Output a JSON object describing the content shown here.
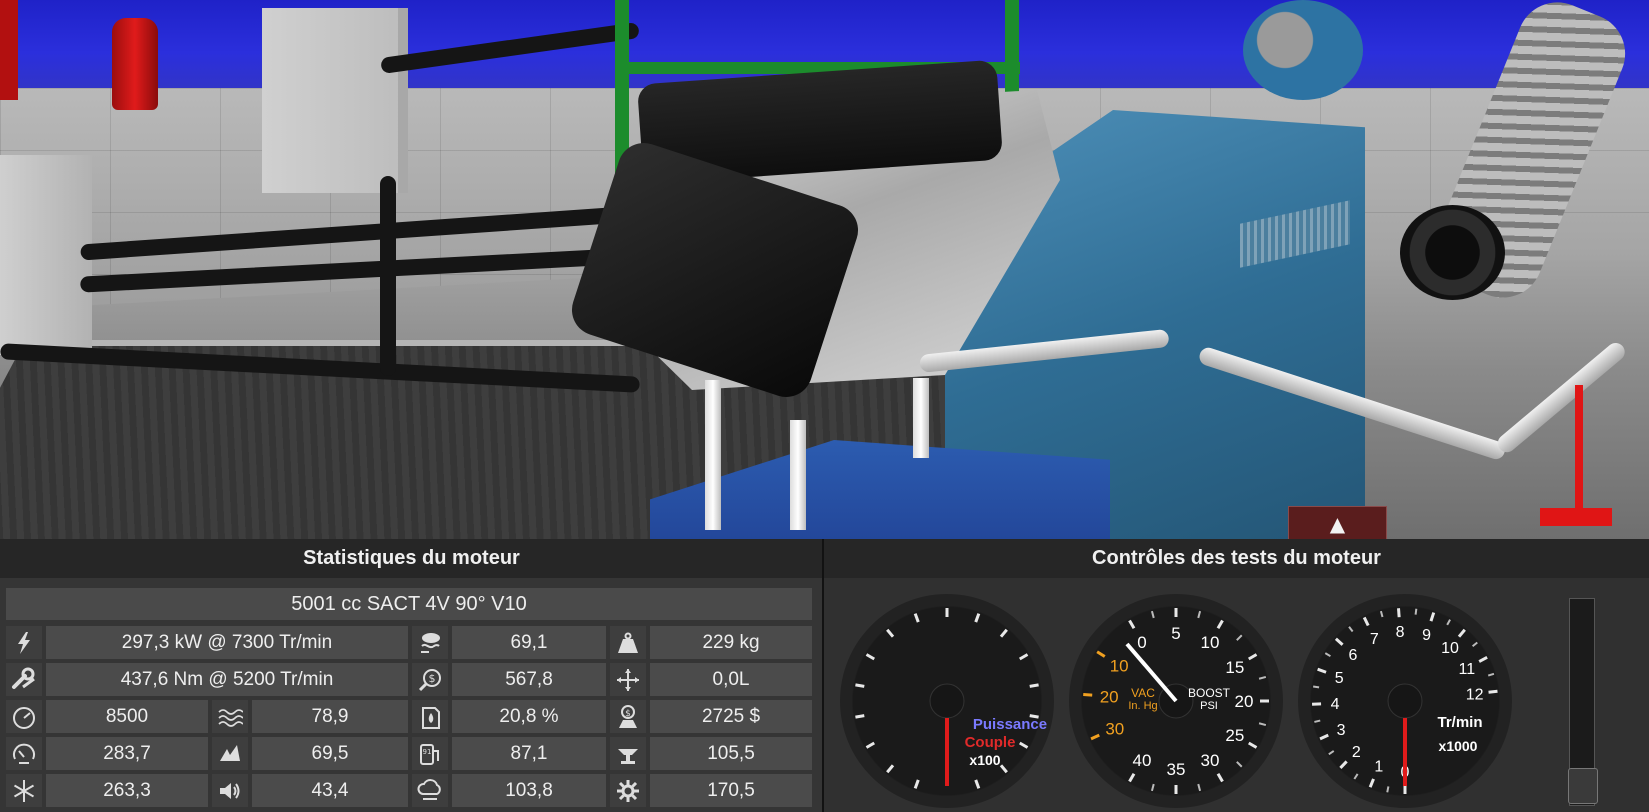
{
  "scene": {
    "collapse_arrow": "▲"
  },
  "stats": {
    "title": "Statistiques du moteur",
    "engine_name": "5001 cc SACT 4V 90° V10",
    "rows": [
      {
        "power": {
          "icon": "power-icon",
          "value": "297,3 kW @ 7300 Tr/min"
        },
        "c2": {
          "icon": "emissions-icon",
          "value": "69,1"
        },
        "c3": {
          "icon": "weight-icon",
          "value": "229 kg"
        }
      },
      {
        "torque": {
          "icon": "torque-wrench-icon",
          "value": "437,6 Nm @ 5200 Tr/min"
        },
        "c2": {
          "icon": "service-cost-icon",
          "value": "567,8"
        },
        "c3": {
          "icon": "dimensions-icon",
          "value": "0,0L"
        }
      },
      {
        "c0": {
          "icon": "redline-gauge-icon",
          "value": "8500"
        },
        "c1": {
          "icon": "smoothness-icon",
          "value": "78,9"
        },
        "c2": {
          "icon": "fuel-economy-icon",
          "value": "20,8 %"
        },
        "c3": {
          "icon": "cost-icon",
          "value": "2725 $"
        }
      },
      {
        "c0": {
          "icon": "speedometer-icon",
          "value": "283,7"
        },
        "c1": {
          "icon": "responsiveness-icon",
          "value": "69,5"
        },
        "c2": {
          "icon": "fuel-pump-icon",
          "value": "87,1"
        },
        "c3": {
          "icon": "production-units-icon",
          "value": "105,5"
        }
      },
      {
        "c0": {
          "icon": "snowflake-icon",
          "value": "263,3"
        },
        "c1": {
          "icon": "speaker-icon",
          "value": "43,4"
        },
        "c2": {
          "icon": "cloud-emissions-icon",
          "value": "103,8"
        },
        "c3": {
          "icon": "gear-icon",
          "value": "170,5"
        }
      }
    ]
  },
  "tests": {
    "title": "Contrôles des tests du moteur",
    "power_gauge": {
      "label_power": "Puissance",
      "label_torque": "Couple",
      "multiplier": "x100",
      "power_color": "#7a7aff",
      "torque_color": "#e02a2a"
    },
    "boost_gauge": {
      "boost_ticks": [
        "0",
        "5",
        "10",
        "15",
        "20",
        "25",
        "30",
        "35",
        "40"
      ],
      "vac_ticks": [
        "10",
        "20",
        "30"
      ],
      "vac_label": "VAC",
      "vac_unit": "In. Hg",
      "boost_label": "BOOST",
      "boost_unit": "PSI",
      "vac_color": "#f0a020"
    },
    "rpm_gauge": {
      "ticks": [
        "0",
        "1",
        "2",
        "3",
        "4",
        "5",
        "6",
        "7",
        "8",
        "9",
        "10",
        "11",
        "12"
      ],
      "unit": "Tr/min",
      "multiplier": "x1000"
    }
  }
}
